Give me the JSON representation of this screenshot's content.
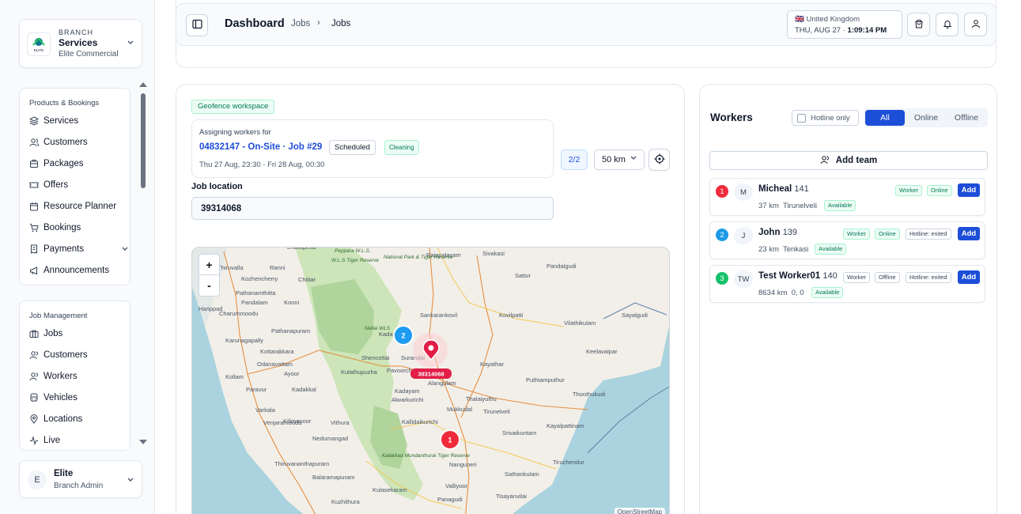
{
  "sidebar": {
    "branch": {
      "kicker": "BRANCH",
      "name": "Services",
      "sub": "Elite Commercial",
      "logo_text": "ELITE"
    },
    "products": {
      "title": "Products & Bookings",
      "items": [
        {
          "label": "Services",
          "icon": "layers-icon"
        },
        {
          "label": "Customers",
          "icon": "users-icon"
        },
        {
          "label": "Packages",
          "icon": "box-icon"
        },
        {
          "label": "Offers",
          "icon": "ticket-icon"
        },
        {
          "label": "Resource Planner",
          "icon": "calendar-icon"
        },
        {
          "label": "Bookings",
          "icon": "cart-icon"
        },
        {
          "label": "Payments",
          "icon": "receipt-icon"
        },
        {
          "label": "Announcements",
          "icon": "megaphone-icon"
        }
      ]
    },
    "jobs": {
      "title": "Job Management",
      "items": [
        {
          "label": "Jobs",
          "icon": "briefcase-icon"
        },
        {
          "label": "Customers",
          "icon": "users-icon"
        },
        {
          "label": "Workers",
          "icon": "users-icon"
        },
        {
          "label": "Vehicles",
          "icon": "vehicle-icon"
        },
        {
          "label": "Locations",
          "icon": "pin-icon"
        },
        {
          "label": "Live",
          "icon": "activity-icon"
        }
      ]
    },
    "user": {
      "initial": "E",
      "name": "Elite",
      "role": "Branch Admin"
    }
  },
  "header": {
    "title": "Dashboard",
    "breadcrumbs": [
      "Jobs",
      "Jobs"
    ],
    "separator": "›",
    "clock": {
      "flag": "🇬🇧",
      "country": "United Kingdom",
      "date": "THU, AUG 27",
      "dot": "·",
      "time": "1:09:14 PM"
    }
  },
  "assign": {
    "workspace_badge": "Geofence workspace",
    "label": "Assigning workers for",
    "job": "04832147 - On-Site · Job #29",
    "status": "Scheduled",
    "category": "Cleaning",
    "time_range": "Thu 27 Aug, 23:30 - Fri 28 Aug, 00:30",
    "count": "2/2",
    "radius": "50 km",
    "location_label": "Job location",
    "location_value": "39314068"
  },
  "map": {
    "zoom_in": "+",
    "zoom_out": "-",
    "attribution": "OpenStreetMap",
    "job_marker_label": "39314068",
    "cluster_markers": [
      "2",
      "1"
    ],
    "places": [
      "Erattupetta",
      "Rajapalayam",
      "Sivakasi",
      "Thiruvalla",
      "Ranni",
      "Kozhencherry",
      "Chittar",
      "Sattur",
      "Pandalgudi",
      "Pathanamthitta",
      "Pandalam",
      "Konni",
      "Harippad",
      "Charummoodu",
      "Sankarankovil",
      "Kovilpatti",
      "Sayalgudi",
      "Pathanapuram",
      "Karunagapally",
      "Kottarakkara",
      "Vilathikulam",
      "Kadayanallur",
      "Odanavattam",
      "Shencottai",
      "Surandai",
      "Keelavaipar",
      "Ayoor",
      "Kulathupuzha",
      "Pavoorchathram",
      "Kayathar",
      "Kollam",
      "Puthiamputhur",
      "Paravur",
      "Kadakkal",
      "Alangulam",
      "Kadayam",
      "Alwarkurichi",
      "Thoothukudi",
      "Varkala",
      "Kilimanoor",
      "Thalaiyuthu",
      "Mukkudal",
      "Tirunelveli",
      "Kallidaikurichi",
      "Venjaramoodu",
      "Vithura",
      "Nedumangad",
      "Srivaikuntam",
      "Kayalpattinam",
      "Tiruchendur",
      "Thiruvananthapuram",
      "Nanguneri",
      "Sathankulam",
      "Balaramapuram",
      "Kulasekaram",
      "Valliyoor",
      "Kuzhithura",
      "Panagudi",
      "Tisayanvilai"
    ],
    "park_labels": [
      "Peppara W.L.S.",
      "Nellai WLS",
      "Kalakkad Mundanthurai Tiger Reserve",
      "W.L.S Tiger Reserve",
      "National Park & Tiger Reserve"
    ]
  },
  "workers_panel": {
    "title": "Workers",
    "hotline_only": "Hotline only",
    "filters": [
      "All",
      "Online",
      "Offline"
    ],
    "active_filter": "All",
    "add_team": "Add team",
    "list": [
      {
        "rank": "1",
        "rank_color": "#ef2b3b",
        "initials": "M",
        "name": "Micheal",
        "id": "141",
        "distance": "37 km",
        "place": "Tirunelveli",
        "availability": "Available",
        "role": "Worker",
        "status": "Online",
        "hotline": "",
        "action": "Add"
      },
      {
        "rank": "2",
        "rank_color": "#1c9be6",
        "initials": "J",
        "name": "John",
        "id": "139",
        "distance": "23 km",
        "place": "Tenkasi",
        "availability": "Available",
        "role": "Worker",
        "status": "Online",
        "hotline": "Hotline: exited",
        "action": "Add"
      },
      {
        "rank": "3",
        "rank_color": "#16c06a",
        "initials": "TW",
        "name": "Test Worker01",
        "id": "140",
        "distance": "8634 km",
        "place": "0, 0",
        "availability": "Available",
        "role": "Worker",
        "status": "Offline",
        "hotline": "Hotline: exited",
        "action": "Add"
      }
    ]
  },
  "colors": {
    "accent": "#1d4ed8",
    "success": "#047857",
    "danger": "#e11d48"
  }
}
